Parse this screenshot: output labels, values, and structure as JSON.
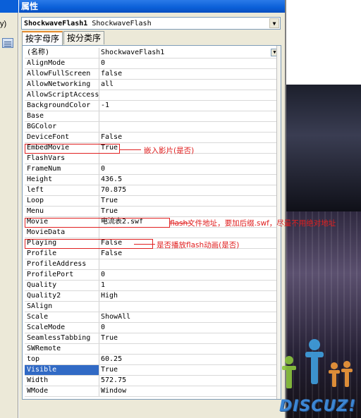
{
  "window": {
    "title": "属性"
  },
  "left_strip": {
    "menu_fragment": "y)"
  },
  "object_selector": {
    "name": "ShockwaveFlash1",
    "type": "ShockwaveFlash"
  },
  "tabs": [
    {
      "label": "按字母序",
      "active": true
    },
    {
      "label": "按分类序",
      "active": false
    }
  ],
  "properties": [
    {
      "name": "(名称)",
      "value": "ShockwaveFlash1"
    },
    {
      "name": "AlignMode",
      "value": "0"
    },
    {
      "name": "AllowFullScreen",
      "value": "false"
    },
    {
      "name": "AllowNetworking",
      "value": "all"
    },
    {
      "name": "AllowScriptAccess",
      "value": ""
    },
    {
      "name": "BackgroundColor",
      "value": "-1"
    },
    {
      "name": "Base",
      "value": ""
    },
    {
      "name": "BGColor",
      "value": ""
    },
    {
      "name": "DeviceFont",
      "value": "False"
    },
    {
      "name": "EmbedMovie",
      "value": "True"
    },
    {
      "name": "FlashVars",
      "value": ""
    },
    {
      "name": "FrameNum",
      "value": "0"
    },
    {
      "name": "Height",
      "value": "436.5"
    },
    {
      "name": "left",
      "value": "70.875"
    },
    {
      "name": "Loop",
      "value": "True"
    },
    {
      "name": "Menu",
      "value": "True"
    },
    {
      "name": "Movie",
      "value": "电流表2.swf"
    },
    {
      "name": "MovieData",
      "value": ""
    },
    {
      "name": "Playing",
      "value": "False"
    },
    {
      "name": "Profile",
      "value": "False"
    },
    {
      "name": "ProfileAddress",
      "value": ""
    },
    {
      "name": "ProfilePort",
      "value": "0"
    },
    {
      "name": "Quality",
      "value": "1"
    },
    {
      "name": "Quality2",
      "value": "High"
    },
    {
      "name": "SAlign",
      "value": ""
    },
    {
      "name": "Scale",
      "value": "ShowAll"
    },
    {
      "name": "ScaleMode",
      "value": "0"
    },
    {
      "name": "SeamlessTabbing",
      "value": "True"
    },
    {
      "name": "SWRemote",
      "value": ""
    },
    {
      "name": "top",
      "value": "60.25"
    },
    {
      "name": "Visible",
      "value": "True"
    },
    {
      "name": "Width",
      "value": "572.75"
    },
    {
      "name": "WMode",
      "value": "Window"
    }
  ],
  "selected_property": "Visible",
  "annotations": {
    "embed": "嵌入影片(是否)",
    "movie": "flash文件地址，要加后缀.swf，尽量不用绝对地址",
    "playing": "是否播放flash动画(是否)"
  },
  "watermark": {
    "text": "DISCUZ!"
  },
  "colors": {
    "titlebar": "#0a5fd8",
    "annotation": "#e02020",
    "selection": "#316ac5"
  }
}
